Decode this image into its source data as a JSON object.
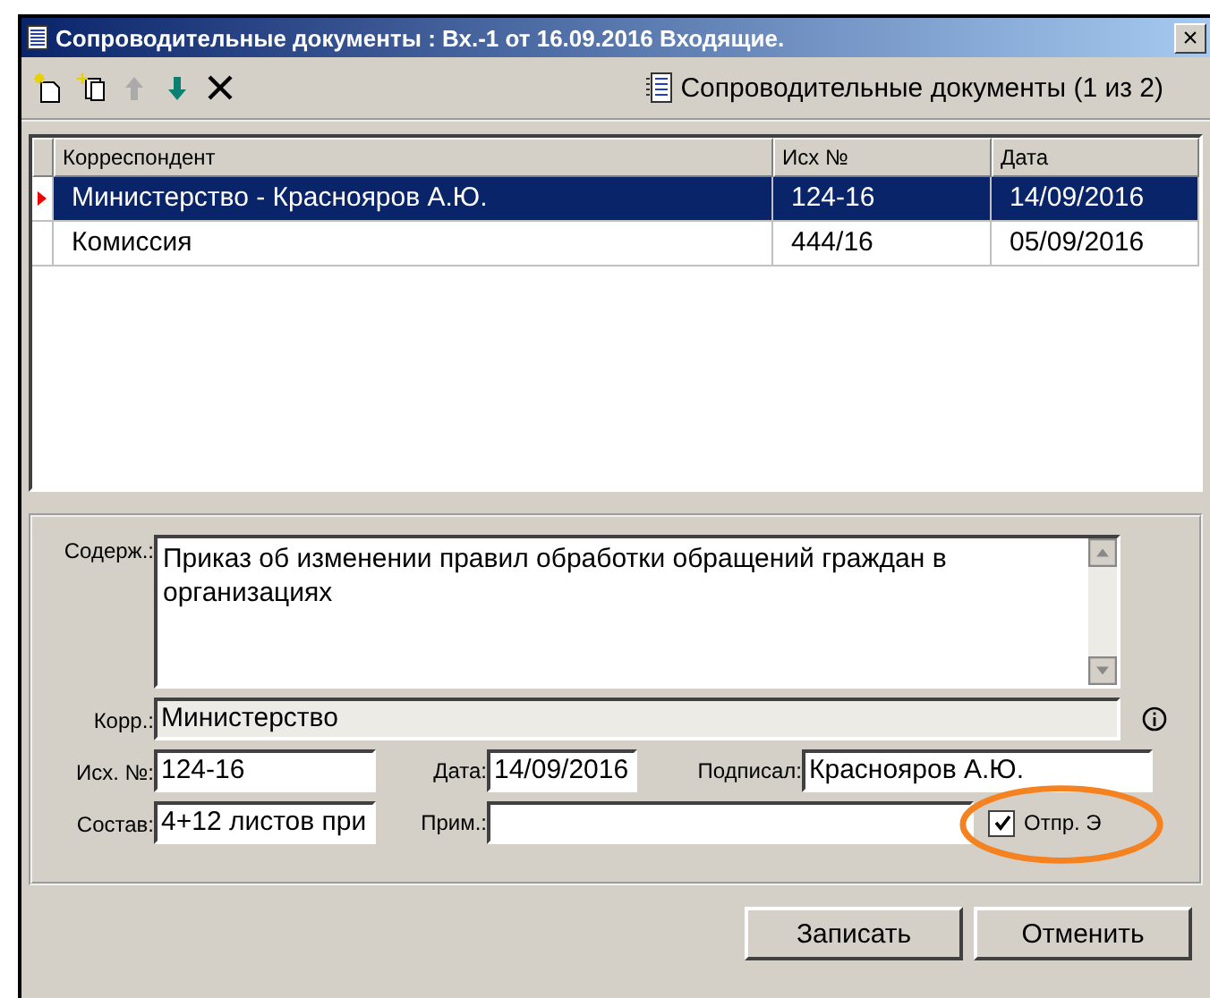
{
  "window": {
    "title": "Сопроводительные документы : Вх.-1 от 16.09.2016 Входящие.",
    "close": "×"
  },
  "toolbar": {
    "caption": "Сопроводительные документы (1 из 2)"
  },
  "table": {
    "columns": [
      "Корреспондент",
      "Исх №",
      "Дата"
    ],
    "rows": [
      {
        "cells": [
          "Министерство - Краснояров А.Ю.",
          "124-16",
          "14/09/2016"
        ],
        "selected": true
      },
      {
        "cells": [
          "Комиссия",
          "444/16",
          "05/09/2016"
        ],
        "selected": false
      }
    ]
  },
  "form": {
    "content_label": "Содерж.:",
    "content": "Приказ об изменении правил обработки обращений граждан в организациях",
    "corr_label": "Корр.:",
    "corr": "Министерство",
    "out_no_label": "Исх. №:",
    "out_no": "124-16",
    "date_label": "Дата:",
    "date": "14/09/2016",
    "signed_label": "Подписал:",
    "signed": "Краснояров А.Ю.",
    "composition_label": "Состав:",
    "composition": "4+12 листов при",
    "note_label": "Прим.:",
    "send_label": "Отпр. Э",
    "send_checked": true,
    "send_highlighted": true
  },
  "buttons": [
    "Записать",
    "Отменить"
  ]
}
